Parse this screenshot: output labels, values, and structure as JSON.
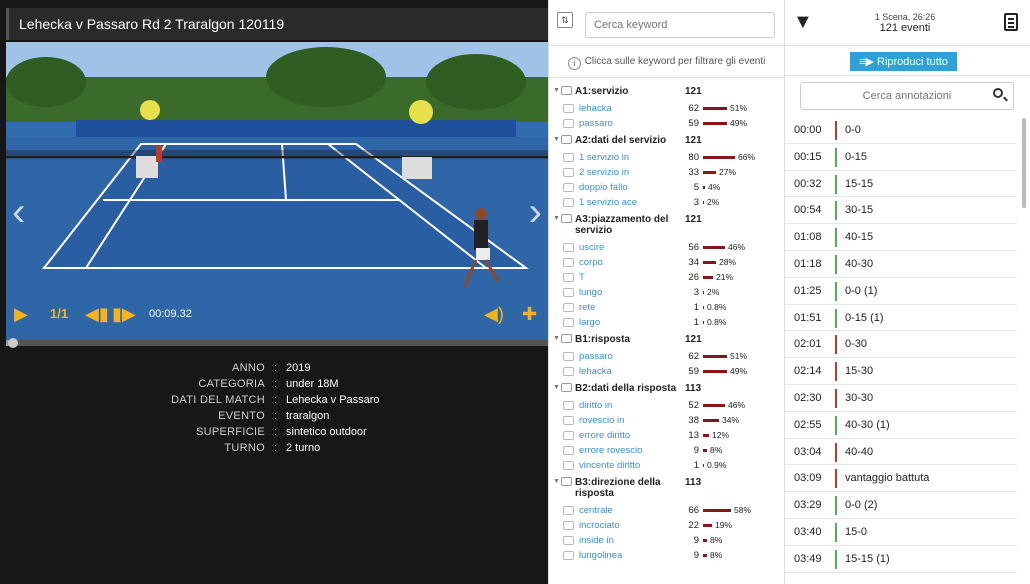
{
  "video": {
    "title": "Lehecka v Passaro Rd 2 Traralgon 120119",
    "time": "00:09.32",
    "speed_label": "1/1",
    "progress": 0.01
  },
  "meta": [
    {
      "key": "ANNO",
      "value": "2019"
    },
    {
      "key": "CATEGORIA",
      "value": "under 18M"
    },
    {
      "key": "DATI DEL MATCH",
      "value": "Lehecka v Passaro"
    },
    {
      "key": "EVENTO",
      "value": "traralgon"
    },
    {
      "key": "SUPERFICIE",
      "value": "sintetico outdoor"
    },
    {
      "key": "TURNO",
      "value": "2 turno"
    }
  ],
  "keywords": {
    "search_placeholder": "Cerca keyword",
    "hint": "Clicca sulle keyword per filtrare gli eventi",
    "groups": [
      {
        "label": "A1:servizio",
        "count": "121",
        "items": [
          {
            "name": "lehacka",
            "num": "62",
            "pct": "51%",
            "frac": 0.51
          },
          {
            "name": "passaro",
            "num": "59",
            "pct": "49%",
            "frac": 0.49
          }
        ]
      },
      {
        "label": "A2:dati del servizio",
        "count": "121",
        "items": [
          {
            "name": "1 servizio in",
            "num": "80",
            "pct": "66%",
            "frac": 0.66
          },
          {
            "name": "2 servizio in",
            "num": "33",
            "pct": "27%",
            "frac": 0.27
          },
          {
            "name": "doppio fallo",
            "num": "5",
            "pct": "4%",
            "frac": 0.04
          },
          {
            "name": "1 servizio ace",
            "num": "3",
            "pct": "2%",
            "frac": 0.02
          }
        ]
      },
      {
        "label": "A3:piazzamento del servizio",
        "count": "121",
        "items": [
          {
            "name": "uscire",
            "num": "56",
            "pct": "46%",
            "frac": 0.46
          },
          {
            "name": "corpo",
            "num": "34",
            "pct": "28%",
            "frac": 0.28
          },
          {
            "name": "T",
            "num": "26",
            "pct": "21%",
            "frac": 0.21
          },
          {
            "name": "lungo",
            "num": "3",
            "pct": "2%",
            "frac": 0.02
          },
          {
            "name": "rete",
            "num": "1",
            "pct": "0.8%",
            "frac": 0.008
          },
          {
            "name": "largo",
            "num": "1",
            "pct": "0.8%",
            "frac": 0.008
          }
        ]
      },
      {
        "label": "B1:risposta",
        "count": "121",
        "items": [
          {
            "name": "passaro",
            "num": "62",
            "pct": "51%",
            "frac": 0.51
          },
          {
            "name": "lehacka",
            "num": "59",
            "pct": "49%",
            "frac": 0.49
          }
        ]
      },
      {
        "label": "B2:dati della risposta",
        "count": "113",
        "items": [
          {
            "name": "diritto in",
            "num": "52",
            "pct": "46%",
            "frac": 0.46
          },
          {
            "name": "rovescio in",
            "num": "38",
            "pct": "34%",
            "frac": 0.34
          },
          {
            "name": "errore diritto",
            "num": "13",
            "pct": "12%",
            "frac": 0.12
          },
          {
            "name": "errore rovescio",
            "num": "9",
            "pct": "8%",
            "frac": 0.08
          },
          {
            "name": "vincente diritto",
            "num": "1",
            "pct": "0.9%",
            "frac": 0.009
          }
        ]
      },
      {
        "label": "B3:direzione della risposta",
        "count": "113",
        "items": [
          {
            "name": "centrale",
            "num": "66",
            "pct": "58%",
            "frac": 0.58
          },
          {
            "name": "incrociato",
            "num": "22",
            "pct": "19%",
            "frac": 0.19
          },
          {
            "name": "inside in",
            "num": "9",
            "pct": "8%",
            "frac": 0.08
          },
          {
            "name": "lungolinea",
            "num": "9",
            "pct": "8%",
            "frac": 0.08
          }
        ]
      }
    ]
  },
  "events_panel": {
    "scene_line1": "1 Scena, 26:26",
    "scene_line2": "121 eventi",
    "play_all": "Riproduci tutto",
    "search_placeholder": "Cerca annotazioni",
    "events": [
      {
        "time": "00:00",
        "label": "0-0",
        "color": "#c0392b"
      },
      {
        "time": "00:15",
        "label": "0-15",
        "color": "#4caf50"
      },
      {
        "time": "00:32",
        "label": "15-15",
        "color": "#4caf50"
      },
      {
        "time": "00:54",
        "label": "30-15",
        "color": "#4caf50"
      },
      {
        "time": "01:08",
        "label": "40-15",
        "color": "#4caf50"
      },
      {
        "time": "01:18",
        "label": "40-30",
        "color": "#4caf50"
      },
      {
        "time": "01:25",
        "label": "0-0 (1)",
        "color": "#4caf50"
      },
      {
        "time": "01:51",
        "label": "0-15 (1)",
        "color": "#4caf50"
      },
      {
        "time": "02:01",
        "label": "0-30",
        "color": "#c0392b"
      },
      {
        "time": "02:14",
        "label": "15-30",
        "color": "#c0392b"
      },
      {
        "time": "02:30",
        "label": "30-30",
        "color": "#c0392b"
      },
      {
        "time": "02:55",
        "label": "40-30 (1)",
        "color": "#4caf50"
      },
      {
        "time": "03:04",
        "label": "40-40",
        "color": "#c0392b"
      },
      {
        "time": "03:09",
        "label": "vantaggio battuta",
        "color": "#c0392b"
      },
      {
        "time": "03:29",
        "label": "0-0 (2)",
        "color": "#4caf50"
      },
      {
        "time": "03:40",
        "label": "15-0",
        "color": "#4caf50"
      },
      {
        "time": "03:49",
        "label": "15-15 (1)",
        "color": "#4caf50"
      }
    ]
  }
}
